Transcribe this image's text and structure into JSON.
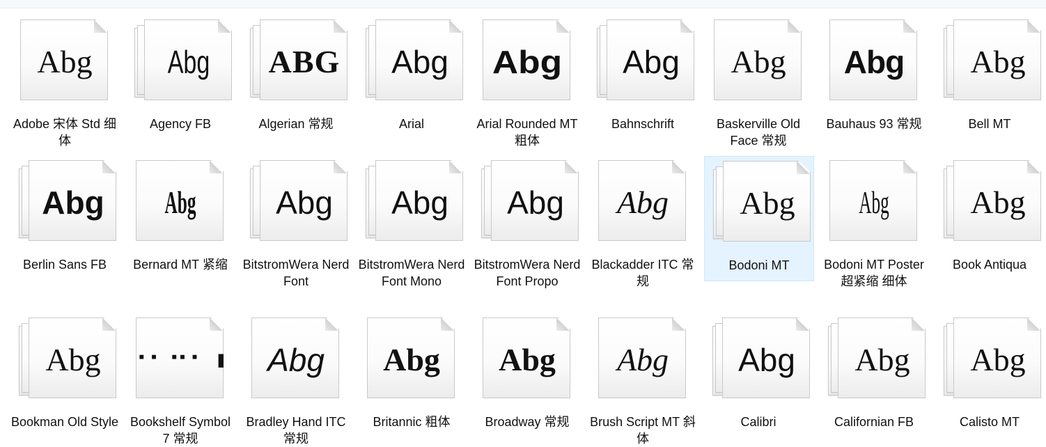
{
  "window": {
    "top_bar_color": "#f7f8fa",
    "selected_color": "#e5f3ff"
  },
  "fonts": [
    {
      "name": "Adobe 宋体 Std 细体",
      "sample": "Abg",
      "icon": "font-file-icon",
      "stack": "single"
    },
    {
      "name": "Agency FB",
      "sample": "Abg",
      "icon": "font-family-icon",
      "stack": "stack"
    },
    {
      "name": "Algerian 常规",
      "sample": "ABG",
      "icon": "font-file-icon",
      "stack": "stack"
    },
    {
      "name": "Arial",
      "sample": "Abg",
      "icon": "font-family-icon",
      "stack": "stack"
    },
    {
      "name": "Arial Rounded MT 粗体",
      "sample": "Abg",
      "icon": "font-file-icon",
      "stack": "single"
    },
    {
      "name": "Bahnschrift",
      "sample": "Abg",
      "icon": "font-family-icon",
      "stack": "stack"
    },
    {
      "name": "Baskerville Old Face 常规",
      "sample": "Abg",
      "icon": "font-file-icon",
      "stack": "single"
    },
    {
      "name": "Bauhaus 93 常规",
      "sample": "Abg",
      "icon": "font-file-icon",
      "stack": "single"
    },
    {
      "name": "Bell MT",
      "sample": "Abg",
      "icon": "font-family-icon",
      "stack": "stack"
    },
    {
      "name": "Berlin Sans FB",
      "sample": "Abg",
      "icon": "font-family-icon",
      "stack": "stack"
    },
    {
      "name": "Bernard MT 紧缩",
      "sample": "Abg",
      "icon": "font-file-icon",
      "stack": "single"
    },
    {
      "name": "BitstromWera Nerd Font",
      "sample": "Abg",
      "icon": "font-family-icon",
      "stack": "stack"
    },
    {
      "name": "BitstromWera Nerd Font Mono",
      "sample": "Abg",
      "icon": "font-family-icon",
      "stack": "stack"
    },
    {
      "name": "BitstromWera Nerd Font Propo",
      "sample": "Abg",
      "icon": "font-family-icon",
      "stack": "stack"
    },
    {
      "name": "Blackadder ITC 常规",
      "sample": "Abg",
      "icon": "font-file-icon",
      "stack": "single"
    },
    {
      "name": "Bodoni MT",
      "sample": "Abg",
      "icon": "font-family-icon",
      "stack": "stack",
      "selected": true
    },
    {
      "name": "Bodoni MT Poster 超紧缩 细体",
      "sample": "Abg",
      "icon": "font-file-icon",
      "stack": "single"
    },
    {
      "name": "Book Antiqua",
      "sample": "Abg",
      "icon": "font-family-icon",
      "stack": "stack"
    },
    {
      "name": "Bookman Old Style",
      "sample": "Abg",
      "icon": "font-family-icon",
      "stack": "stack"
    },
    {
      "name": "Bookshelf Symbol 7 常规",
      "sample": "⠐⠂⠒⠂ ■",
      "icon": "font-file-icon",
      "stack": "single"
    },
    {
      "name": "Bradley Hand ITC 常规",
      "sample": "Abg",
      "icon": "font-file-icon",
      "stack": "single"
    },
    {
      "name": "Britannic 粗体",
      "sample": "Abg",
      "icon": "font-file-icon",
      "stack": "single"
    },
    {
      "name": "Broadway 常规",
      "sample": "Abg",
      "icon": "font-file-icon",
      "stack": "single"
    },
    {
      "name": "Brush Script MT 斜体",
      "sample": "Abg",
      "icon": "font-file-icon",
      "stack": "single"
    },
    {
      "name": "Calibri",
      "sample": "Abg",
      "icon": "font-family-icon",
      "stack": "stack"
    },
    {
      "name": "Californian FB",
      "sample": "Abg",
      "icon": "font-family-icon",
      "stack": "stack"
    },
    {
      "name": "Calisto MT",
      "sample": "Abg",
      "icon": "font-family-icon",
      "stack": "stack"
    }
  ]
}
